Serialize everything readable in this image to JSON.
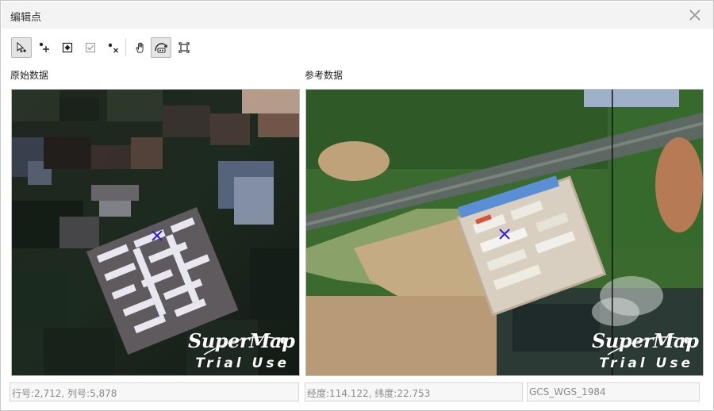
{
  "dialog": {
    "title": "编辑点"
  },
  "toolbar": {
    "buttons": [
      {
        "name": "select-tool",
        "icon": "select-arrow-icon",
        "active": true
      },
      {
        "name": "add-point-tool",
        "icon": "add-point-icon",
        "active": false
      },
      {
        "name": "edit-point-tool",
        "icon": "edit-point-icon",
        "active": false
      },
      {
        "name": "check-tool",
        "icon": "checkbox-icon",
        "active": false
      },
      {
        "name": "delete-point-tool",
        "icon": "delete-point-icon",
        "active": false
      },
      {
        "name": "pan-tool",
        "icon": "hand-pan-icon",
        "active": false
      },
      {
        "name": "sync-view-tool",
        "icon": "sync-view-icon",
        "active": true
      },
      {
        "name": "full-extent-tool",
        "icon": "full-extent-icon",
        "active": false
      }
    ]
  },
  "panels": {
    "left_label": "原始数据",
    "right_label": "参考数据"
  },
  "watermark": {
    "logo": "SuperMap",
    "sub": "Trial Use"
  },
  "status": {
    "row_col": "行号:2,712, 列号:5,878",
    "lon_lat": "经度:114.122, 纬度:22.753",
    "crs": "GCS_WGS_1984"
  },
  "colors": {
    "marker": "#2a1fd6",
    "titlebar": "#f3f3f3"
  }
}
